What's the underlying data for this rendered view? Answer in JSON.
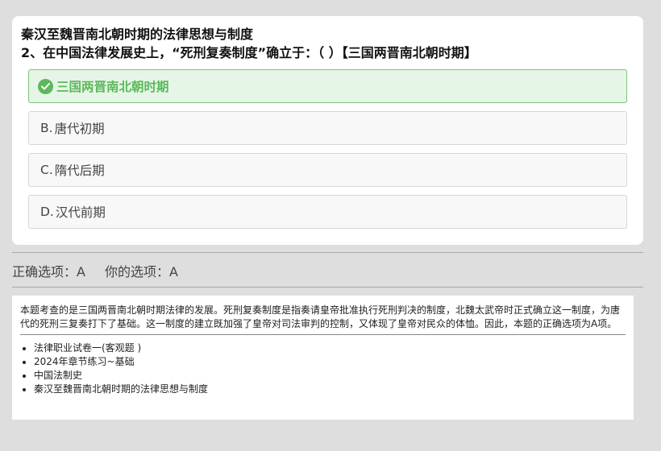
{
  "question": {
    "chapter_title": "秦汉至魏晋南北朝时期的法律思想与制度",
    "text": "2、在中国法律发展史上，“死刑复奏制度”确立于：（ ）【三国两晋南北朝时期】",
    "options": [
      {
        "letter": "",
        "text": "三国两晋南北朝时期",
        "state": "correct"
      },
      {
        "letter": "B.",
        "text": "唐代初期",
        "state": "normal"
      },
      {
        "letter": "C.",
        "text": "隋代后期",
        "state": "normal"
      },
      {
        "letter": "D.",
        "text": "汉代前期",
        "state": "normal"
      }
    ]
  },
  "result": {
    "correct_label": "正确选项：A",
    "your_label": "你的选项：A"
  },
  "explanation": {
    "text": "本题考查的是三国两晋南北朝时期法律的发展。死刑复奏制度是指奏请皇帝批准执行死刑判决的制度，北魏太武帝时正式确立这一制度，为唐代的死刑三复奏打下了基础。这一制度的建立既加强了皇帝对司法审判的控制，又体现了皇帝对民众的体恤。因此，本题的正确选项为A项。",
    "tags": [
      "法律职业试卷一(客观题 )",
      "2024年章节练习~基础",
      "中国法制史",
      "秦汉至魏晋南北朝时期的法律思想与制度"
    ]
  },
  "colors": {
    "correct_green": "#5cb85c",
    "correct_bg": "#e6f6e6",
    "page_bg": "#dedede"
  },
  "icons": {
    "correct_option": "check-circle-icon"
  }
}
